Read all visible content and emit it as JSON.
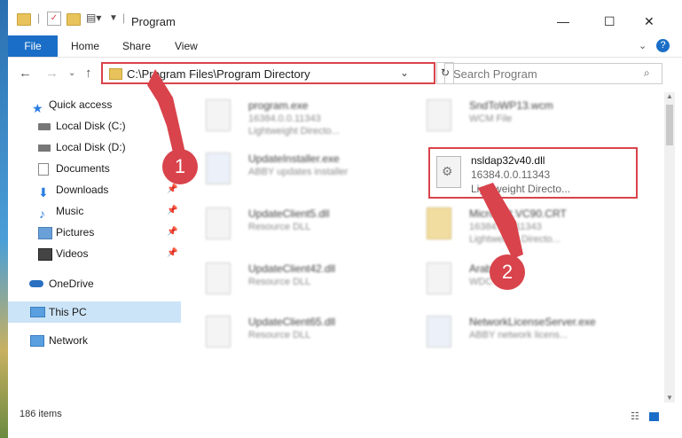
{
  "window": {
    "title": "Program",
    "minimize": "—",
    "maximize": "☐",
    "close": "✕"
  },
  "ribbon": {
    "tabs": [
      "File",
      "Home",
      "Share",
      "View"
    ]
  },
  "address": {
    "path": "C:\\Program Files\\Program Directory",
    "search_placeholder": "Search Program"
  },
  "sidebar": {
    "items": [
      {
        "label": "Quick access",
        "icon": "star-icon"
      },
      {
        "label": "Local Disk (C:)",
        "icon": "drive-icon"
      },
      {
        "label": "Local Disk (D:)",
        "icon": "drive-icon"
      },
      {
        "label": "Documents",
        "icon": "documents-icon"
      },
      {
        "label": "Downloads",
        "icon": "downloads-icon"
      },
      {
        "label": "Music",
        "icon": "music-icon"
      },
      {
        "label": "Pictures",
        "icon": "pictures-icon"
      },
      {
        "label": "Videos",
        "icon": "videos-icon"
      },
      {
        "label": "OneDrive",
        "icon": "cloud-icon"
      },
      {
        "label": "This PC",
        "icon": "pc-icon"
      },
      {
        "label": "Network",
        "icon": "network-icon"
      }
    ]
  },
  "files": [
    {
      "name": "program.exe",
      "l1": "16384.0.0.11343",
      "l2": "Lightweight Directo..."
    },
    {
      "name": "SndToWP13.wcm",
      "l1": "WCM File",
      "l2": ""
    },
    {
      "name": "UpdateInstaller.exe",
      "l1": "ABBY updates installer",
      "l2": ""
    },
    {
      "name": "UpdateClient5.dll",
      "l1": "Resource DLL",
      "l2": ""
    },
    {
      "name": "Microsoft.VC90.CRT",
      "l1": "16384.0.0.11343",
      "l2": "Lightweight Directo..."
    },
    {
      "name": "UpdateClient42.dll",
      "l1": "Resource DLL",
      "l2": ""
    },
    {
      "name": "Arabic",
      "l1": "WDC",
      "l2": ""
    },
    {
      "name": "UpdateClient65.dll",
      "l1": "Resource DLL",
      "l2": ""
    },
    {
      "name": "NetworkLicenseServer.exe",
      "l1": "ABBY network licens...",
      "l2": ""
    }
  ],
  "highlighted_file": {
    "name": "nsldap32v40.dll",
    "version": "16384.0.0.11343",
    "description": "Lightweight Directo..."
  },
  "status": {
    "items": "186 items"
  },
  "badges": {
    "one": "1",
    "two": "2"
  },
  "colors": {
    "accent": "#1a6ec7",
    "highlight": "#d9434b"
  }
}
